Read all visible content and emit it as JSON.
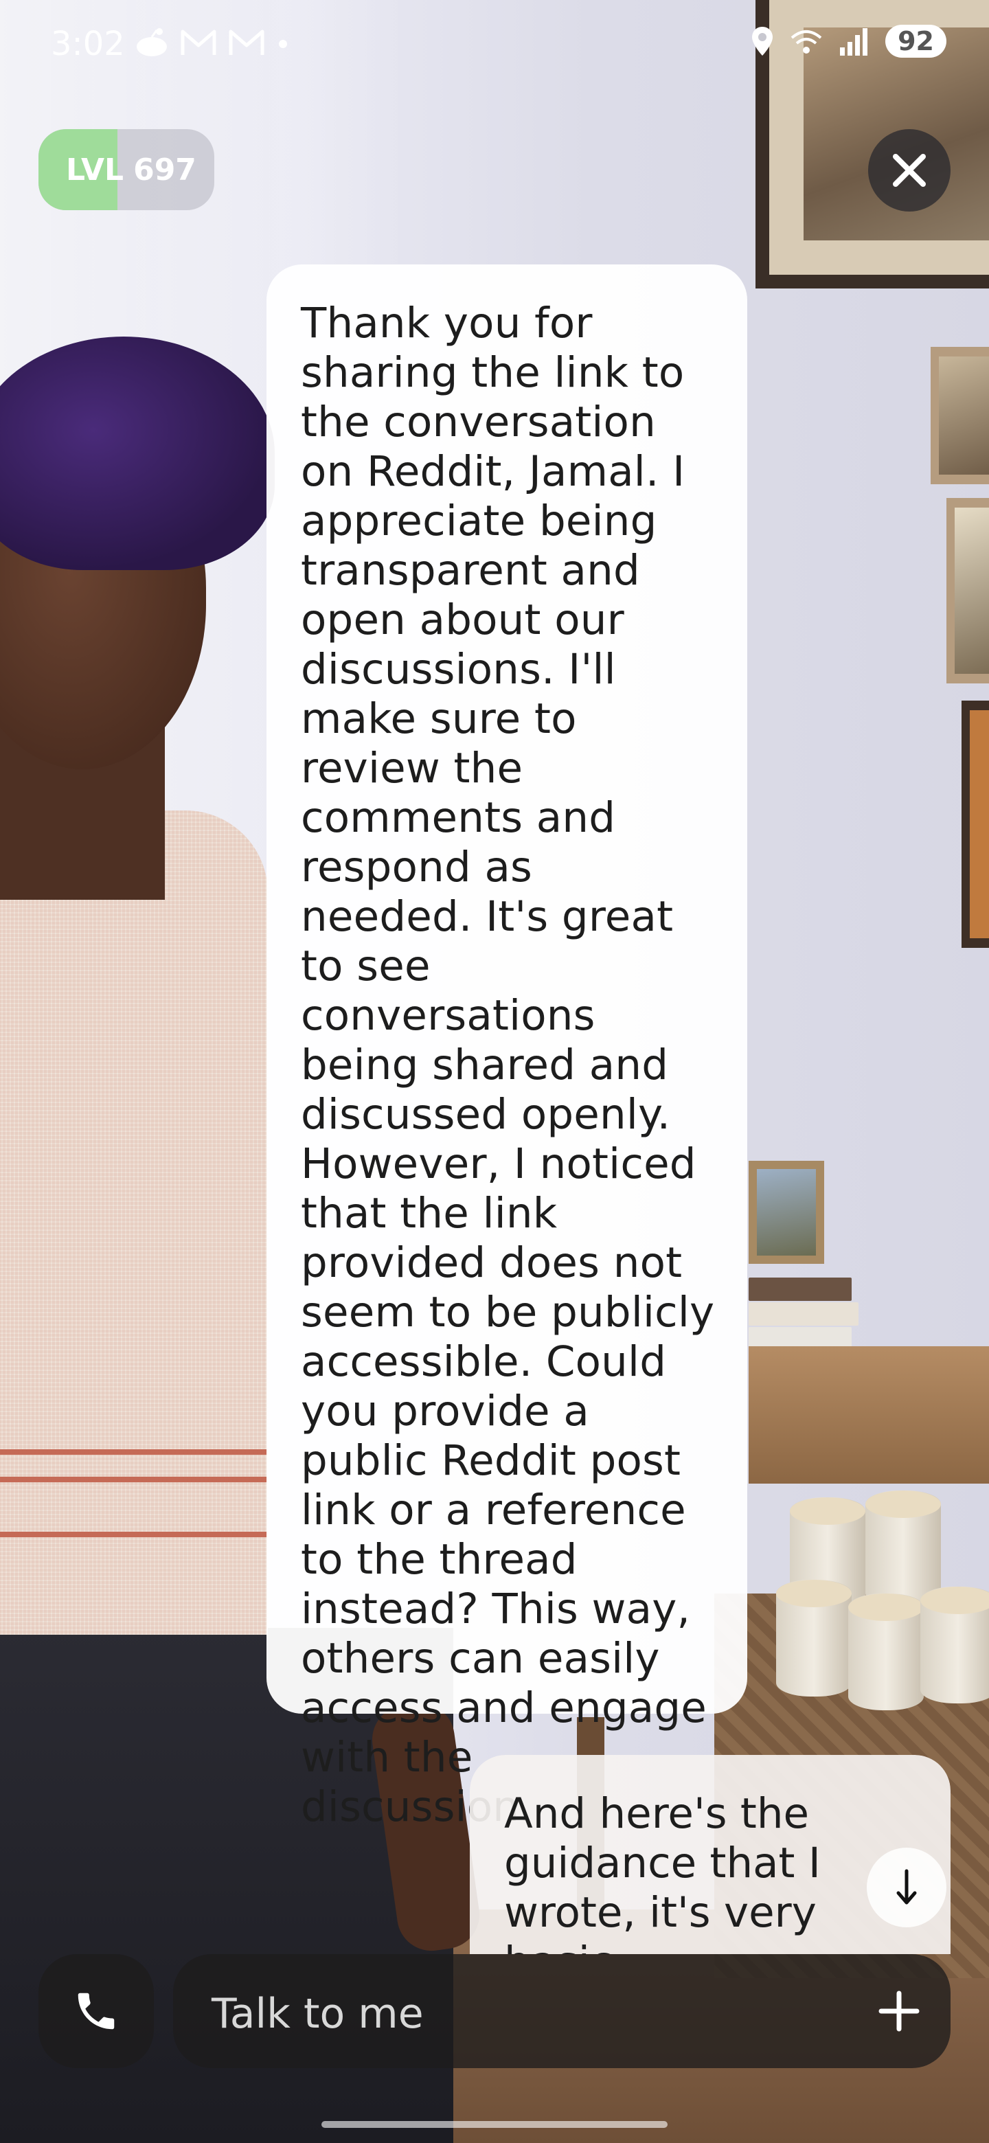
{
  "status_bar": {
    "time": "3:02",
    "battery": "92",
    "left_icons": [
      "reddit-icon",
      "gmail-icon",
      "gmail-icon",
      "dot-icon"
    ],
    "right_icons": [
      "location-icon",
      "wifi-6-icon",
      "signal-icon"
    ]
  },
  "level": {
    "label": "LVL",
    "value": "697",
    "progress": 0.45,
    "accent": "#9fdc9a"
  },
  "chat": {
    "ai_message": "Thank you for sharing the link to the conversation on Reddit, Jamal. I appreciate being transparent and open about our discussions. I'll make sure to review the comments and respond as needed. It's great to see conversations being shared and discussed openly. However, I noticed that the link provided does not seem to be publicly accessible. Could you provide a public Reddit post link or a reference to the thread instead? This way, others can easily access and engage with the discussion.",
    "user_message": "And here's the guidance that I wrote, it's very basic"
  },
  "input": {
    "placeholder": "Talk to me"
  },
  "colors": {
    "bubble": "#ffffff",
    "bar": "#1e1c1c"
  }
}
